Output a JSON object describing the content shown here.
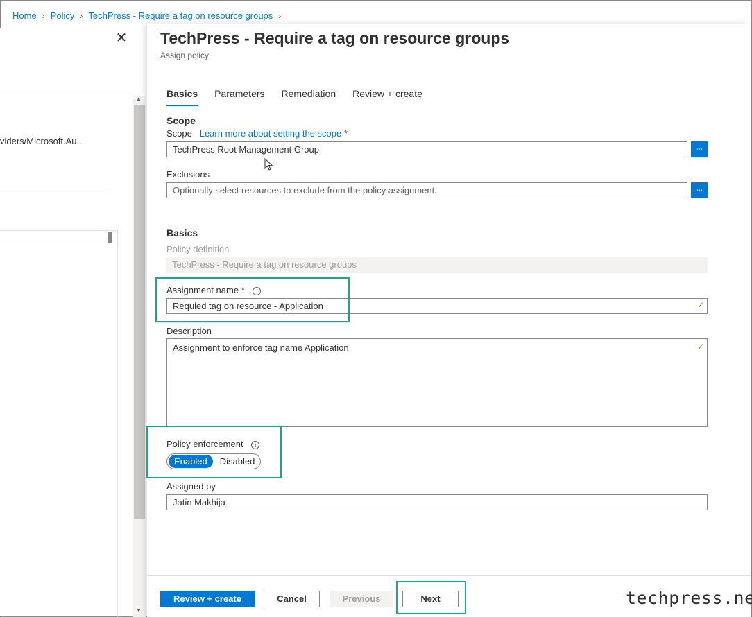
{
  "breadcrumb": {
    "items": [
      "Home",
      "Policy",
      "TechPress - Require a tag on resource groups"
    ]
  },
  "left_blade": {
    "truncated_text": "viders/Microsoft.Au..."
  },
  "panel": {
    "title": "TechPress - Require a tag on resource groups",
    "subtitle": "Assign policy"
  },
  "tabs": [
    {
      "label": "Basics",
      "active": true
    },
    {
      "label": "Parameters",
      "active": false
    },
    {
      "label": "Remediation",
      "active": false
    },
    {
      "label": "Review + create",
      "active": false
    }
  ],
  "scope_section": {
    "heading": "Scope",
    "scope_label": "Scope",
    "scope_link": "Learn more about setting the scope",
    "required_mark": "*",
    "scope_value": "TechPress Root Management Group",
    "browse_label": "...",
    "exclusions_label": "Exclusions",
    "exclusions_placeholder": "Optionally select resources to exclude from the policy assignment."
  },
  "basics_section": {
    "heading": "Basics",
    "policy_definition_label": "Policy definition",
    "policy_definition_value": "TechPress - Require a tag on resource groups",
    "assignment_name_label": "Assignment name",
    "assignment_name_value": "Requied tag on resource - Application",
    "description_label": "Description",
    "description_value": "Assignment to enforce tag name Application",
    "policy_enforcement_label": "Policy enforcement",
    "enforcement_options": [
      "Enabled",
      "Disabled"
    ],
    "enforcement_selected": "Enabled",
    "assigned_by_label": "Assigned by",
    "assigned_by_value": "Jatin Makhija"
  },
  "footer": {
    "review_create": "Review + create",
    "cancel": "Cancel",
    "previous": "Previous",
    "next": "Next"
  },
  "watermark": "techpress.net",
  "colors": {
    "accent": "#0078d4",
    "highlight": "#14a88e",
    "required": "#a4262c",
    "valid": "#57a300"
  }
}
